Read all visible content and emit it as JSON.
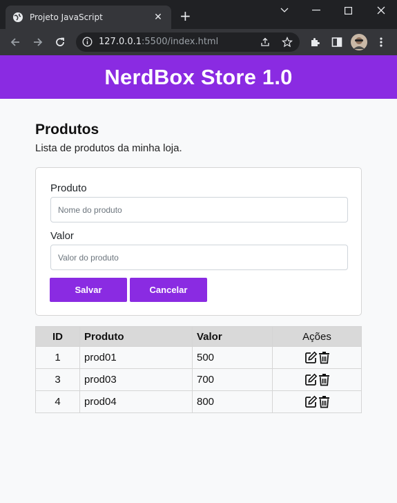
{
  "browser": {
    "tab_title": "Projeto JavaScript",
    "url_host": "127.0.0.1",
    "url_rest": ":5500/index.html"
  },
  "header": {
    "title": "NerdBox Store 1.0"
  },
  "section": {
    "title": "Produtos",
    "subtitle": "Lista de produtos da minha loja."
  },
  "form": {
    "product_label": "Produto",
    "product_placeholder": "Nome do produto",
    "value_label": "Valor",
    "value_placeholder": "Valor do produto",
    "save_label": "Salvar",
    "cancel_label": "Cancelar"
  },
  "table": {
    "headers": [
      "ID",
      "Produto",
      "Valor",
      "Ações"
    ],
    "rows": [
      {
        "id": "1",
        "product": "prod01",
        "value": "500"
      },
      {
        "id": "3",
        "product": "prod03",
        "value": "700"
      },
      {
        "id": "4",
        "product": "prod04",
        "value": "800"
      }
    ]
  },
  "colors": {
    "accent": "#8a2be2",
    "chrome_dark": "#202124",
    "chrome": "#35363a"
  }
}
